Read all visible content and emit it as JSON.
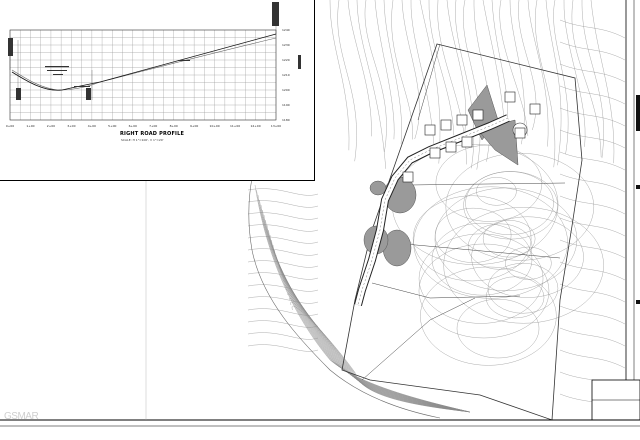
{
  "profile": {
    "title": "RIGHT ROAD PROFILE",
    "scale": "SCALE: H 1\"=100', V 1\"=20'",
    "stations": [
      "0+00",
      "1+00",
      "2+00",
      "3+00",
      "4+00",
      "5+00",
      "6+00",
      "7+00",
      "8+00",
      "9+00",
      "10+00",
      "11+00",
      "12+00",
      "13+00"
    ],
    "elevations": [
      "1240",
      "1230",
      "1220",
      "1210",
      "1200",
      "1190",
      "1180"
    ]
  },
  "watermark": "GSMAR"
}
